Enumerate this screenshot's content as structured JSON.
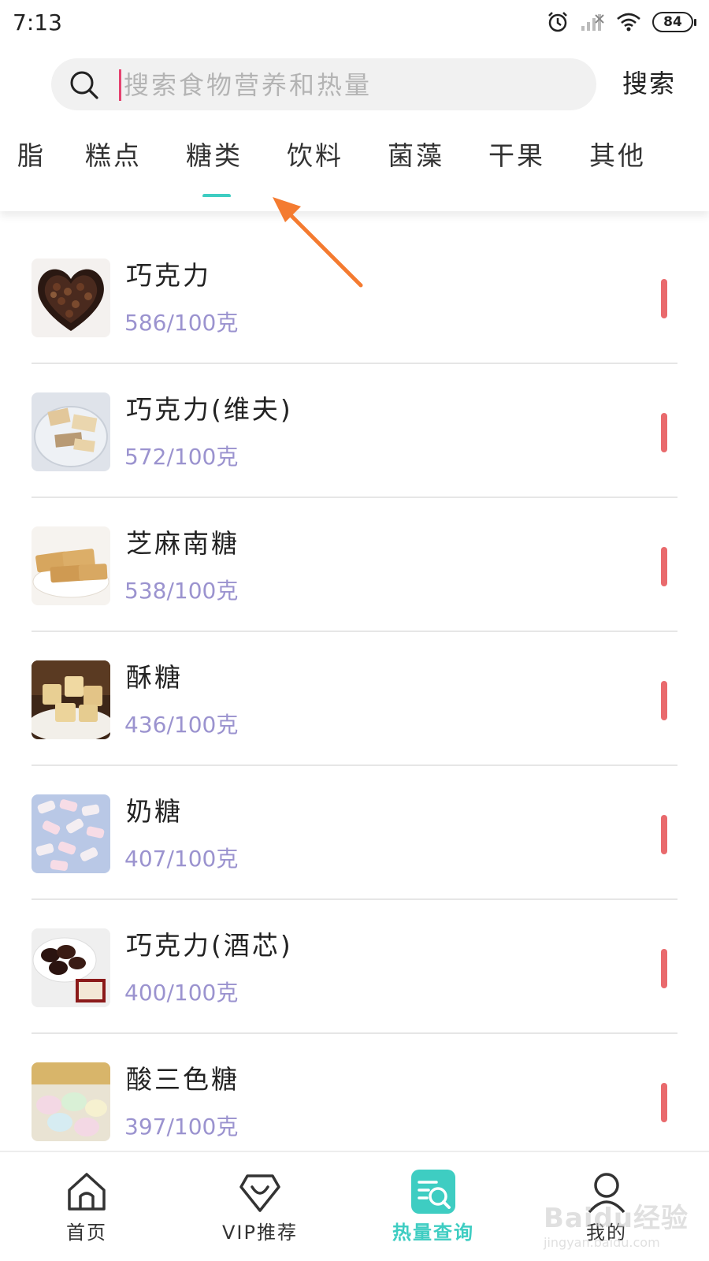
{
  "status_bar": {
    "time": "7:13",
    "battery": "84"
  },
  "search": {
    "placeholder": "搜索食物营养和热量",
    "button_label": "搜索"
  },
  "tabs": [
    {
      "label": "脂"
    },
    {
      "label": "糕点"
    },
    {
      "label": "糖类",
      "active": true
    },
    {
      "label": "饮料"
    },
    {
      "label": "菌藻"
    },
    {
      "label": "干果"
    },
    {
      "label": "其他"
    }
  ],
  "foods": [
    {
      "name": "巧克力",
      "calories": "586/100克",
      "image": "heart-chocolate-box-image"
    },
    {
      "name": "巧克力(维夫)",
      "calories": "572/100克",
      "image": "wafer-chocolate-image"
    },
    {
      "name": "芝麻南糖",
      "calories": "538/100克",
      "image": "sesame-candy-image"
    },
    {
      "name": "酥糖",
      "calories": "436/100克",
      "image": "crisp-candy-image"
    },
    {
      "name": "奶糖",
      "calories": "407/100克",
      "image": "milk-candy-image"
    },
    {
      "name": "巧克力(酒芯)",
      "calories": "400/100克",
      "image": "liqueur-chocolate-image"
    },
    {
      "name": "酸三色糖",
      "calories": "397/100克",
      "image": "tricolor-candy-image"
    }
  ],
  "bottom_nav": [
    {
      "label": "首页",
      "icon": "home-icon"
    },
    {
      "label": "VIP推荐",
      "icon": "vip-icon"
    },
    {
      "label": "热量查询",
      "icon": "calorie-search-icon",
      "active": true
    },
    {
      "label": "我的",
      "icon": "profile-icon"
    }
  ],
  "watermark": {
    "main": "Baidu经验",
    "sub": "jingyan.baidu.com"
  },
  "colors": {
    "accent": "#3ecdc2",
    "calorie_text": "#9b93cf",
    "level_bar": "#e96a6d",
    "caret": "#e5426f",
    "annotation_arrow": "#f47b30"
  }
}
